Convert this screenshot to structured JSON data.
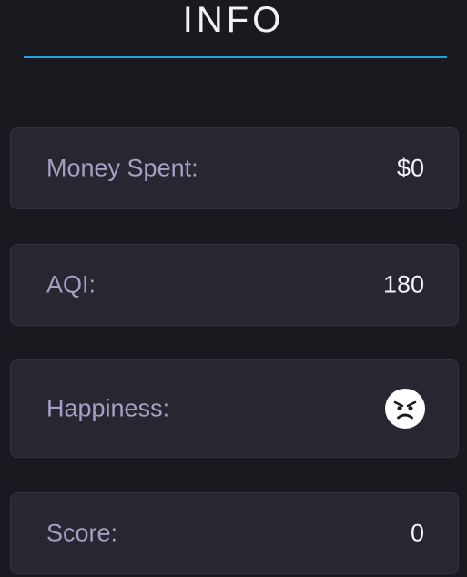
{
  "title": "INFO",
  "colors": {
    "accent": "#19a7d8",
    "background": "#1a1920",
    "card": "#272631",
    "label": "#a59fc4",
    "value": "#f4f4f8"
  },
  "stats": [
    {
      "label": "Money Spent:",
      "value": "$0"
    },
    {
      "label": "AQI:",
      "value": "180"
    },
    {
      "label": "Happiness:",
      "value": "",
      "icon": "angry-face-icon"
    },
    {
      "label": "Score:",
      "value": "0"
    }
  ]
}
